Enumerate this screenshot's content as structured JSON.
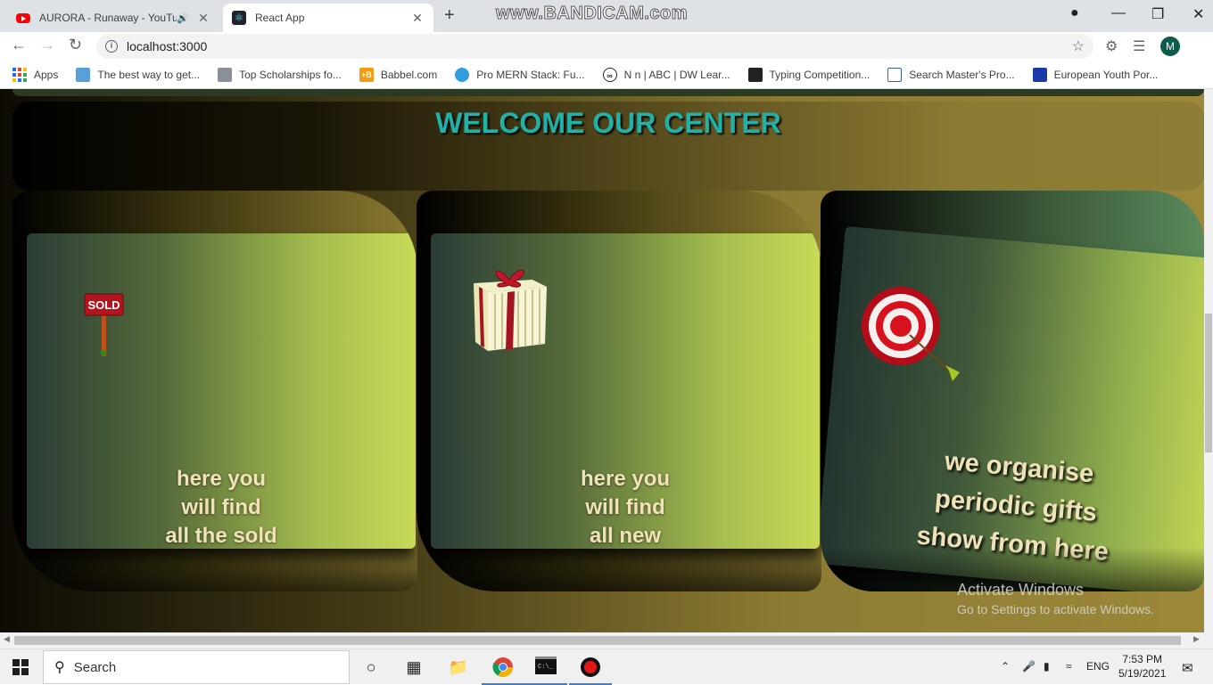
{
  "browser": {
    "tabs": [
      {
        "title": "AURORA - Runaway - YouTube",
        "favicon": "youtube-icon"
      },
      {
        "title": "React App",
        "favicon": "react-icon"
      }
    ],
    "recorder_watermark": "www.BANDICAM.com",
    "url": "localhost:3000",
    "profile_initial": "M",
    "bookmarks": [
      {
        "label": "Apps"
      },
      {
        "label": "The best way to get..."
      },
      {
        "label": "Top Scholarships fo..."
      },
      {
        "label": "Babbel.com"
      },
      {
        "label": "Pro MERN Stack: Fu..."
      },
      {
        "label": "N n | ABC | DW Lear..."
      },
      {
        "label": "Typing Competition..."
      },
      {
        "label": "Search Master's Pro..."
      },
      {
        "label": "European Youth Por..."
      }
    ]
  },
  "page": {
    "title": "WELCOME OUR CENTER",
    "accent_color": "#20b2a8",
    "cards": [
      {
        "lines": [
          "here you",
          "will find",
          "all the sold"
        ],
        "icon": "sold-sign-icon",
        "sign_text": "SOLD"
      },
      {
        "lines": [
          "here you",
          "will find",
          "all new"
        ],
        "icon": "gift-box-icon"
      },
      {
        "lines": [
          "we organise",
          "periodic gifts",
          "show from here"
        ],
        "icon": "target-icon"
      }
    ]
  },
  "os": {
    "activate_title": "Activate Windows",
    "activate_sub": "Go to Settings to activate Windows.",
    "search_placeholder": "Search",
    "language": "ENG",
    "time": "7:53 PM",
    "date": "5/19/2021"
  }
}
